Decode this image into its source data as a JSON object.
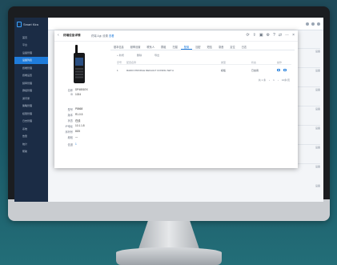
{
  "app": {
    "name": "Smart Kira",
    "logo": "brand-icon"
  },
  "sidebar": {
    "items": [
      {
        "label": "首页",
        "active": false
      },
      {
        "label": "平台",
        "active": false
      },
      {
        "label": "设备管理",
        "active": false
      },
      {
        "label": "设备列表",
        "active": true
      },
      {
        "label": "终端管理",
        "active": false
      },
      {
        "label": "终端设置",
        "active": false
      },
      {
        "label": "频率管理",
        "active": false
      },
      {
        "label": "群组管理",
        "active": false
      },
      {
        "label": "通讯录",
        "active": false
      },
      {
        "label": "策略管理",
        "active": false
      },
      {
        "label": "权限管理",
        "active": false
      },
      {
        "label": "日志管理",
        "active": false
      },
      {
        "label": "系统",
        "active": false
      },
      {
        "label": "告警",
        "active": false
      },
      {
        "label": "统计",
        "active": false
      },
      {
        "label": "帮助",
        "active": false
      }
    ]
  },
  "background": {
    "right_col": [
      "设备",
      "设备",
      "设备",
      "设备",
      "设备",
      "设备",
      "设备",
      "设备"
    ]
  },
  "modal": {
    "title": "终端设备详情",
    "breadcrumb": "终端 &gt; 设置",
    "link": "查看",
    "icons": [
      "reload-icon",
      "export-icon",
      "print-icon",
      "settings-icon",
      "help-icon",
      "share-icon",
      "more-icon",
      "close-icon"
    ],
    "device": {
      "name_label": "名称",
      "name_value": "DP4801EX",
      "id_label": "ID",
      "id_value": "1024",
      "fields": [
        {
          "label": "型号",
          "value": "P8668"
        },
        {
          "label": "版本",
          "value": "R1.0.5"
        },
        {
          "label": "状态",
          "value": "在线"
        },
        {
          "label": "IP地址",
          "value": "10.1.1.8"
        },
        {
          "label": "序列号",
          "value": "8G5"
        },
        {
          "label": "频段",
          "value": "—"
        },
        {
          "label": "信道",
          "value": "1"
        }
      ]
    },
    "tabs": [
      {
        "label": "基本信息",
        "active": false
      },
      {
        "label": "频率设置",
        "active": false
      },
      {
        "label": "联系人",
        "active": false
      },
      {
        "label": "群组",
        "active": false
      },
      {
        "label": "扫描",
        "active": false
      },
      {
        "label": "配置",
        "active": true
      },
      {
        "label": "加密",
        "active": false
      },
      {
        "label": "短信",
        "active": false
      },
      {
        "label": "录音",
        "active": false
      },
      {
        "label": "定位",
        "active": false
      },
      {
        "label": "日志",
        "active": false
      }
    ],
    "toolbar": {
      "add": "+ 新增",
      "delete": "删除",
      "export": "导出"
    },
    "table": {
      "columns": [
        "序号",
        "配置名称",
        "类型",
        "状态",
        "操作"
      ],
      "rows": [
        {
          "index": "1",
          "name": "RADIO PROFILE DEFAULT CONFIG SET A",
          "type": "模板",
          "status": "已启用"
        }
      ]
    },
    "pager": {
      "text": "共 1 条",
      "page": "1",
      "size": "10条/页"
    }
  }
}
